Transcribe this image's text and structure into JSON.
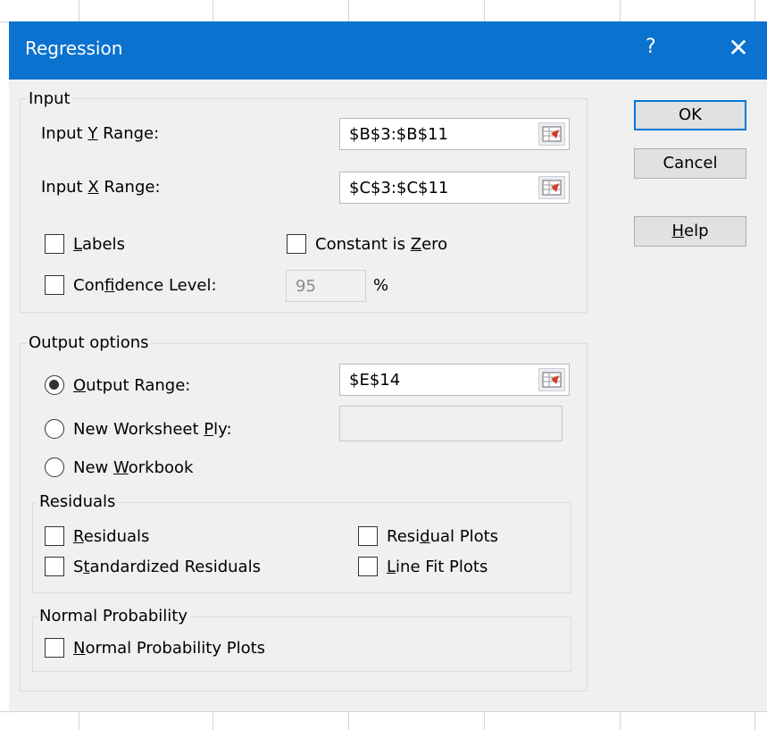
{
  "dialog": {
    "title": "Regression",
    "help_glyph": "?",
    "close_glyph": "✕"
  },
  "buttons": {
    "ok": "OK",
    "cancel": "Cancel",
    "help_prefix": "",
    "help_mnemonic": "H",
    "help_rest": "elp"
  },
  "input": {
    "legend": "Input",
    "y_range": {
      "pre": "Input ",
      "mnemonic": "Y",
      "post": " Range:",
      "value": "$B$3:$B$11"
    },
    "x_range": {
      "pre": "Input ",
      "mnemonic": "X",
      "post": " Range:",
      "value": "$C$3:$C$11"
    },
    "labels": {
      "pre": "",
      "mnemonic": "L",
      "post": "abels",
      "checked": false
    },
    "constant_zero": {
      "pre": "Constant is ",
      "mnemonic": "Z",
      "post": "ero",
      "checked": false
    },
    "confidence": {
      "pre": "Con",
      "mnemonic": "f",
      "post": "idence Level:",
      "value": "95",
      "unit": "%",
      "checked": false
    }
  },
  "output": {
    "legend": "Output options",
    "output_range": {
      "pre": "",
      "mnemonic": "O",
      "post": "utput Range:",
      "value": "$E$14",
      "selected": true
    },
    "new_worksheet": {
      "pre": "New Worksheet ",
      "mnemonic": "P",
      "post": "ly:",
      "value": "",
      "selected": false
    },
    "new_workbook": {
      "pre": "New ",
      "mnemonic": "W",
      "post": "orkbook",
      "selected": false
    }
  },
  "residuals": {
    "legend": "Residuals",
    "residuals": {
      "pre": "",
      "mnemonic": "R",
      "post": "esiduals",
      "checked": false
    },
    "standardized": {
      "pre": "S",
      "mnemonic": "t",
      "post": "andardized Residuals",
      "checked": false
    },
    "residual_plots": {
      "pre": "Resi",
      "mnemonic": "d",
      "post": "ual Plots",
      "checked": false
    },
    "line_fit": {
      "pre": "",
      "mnemonic": "L",
      "post": "ine Fit Plots",
      "checked": false
    }
  },
  "normal": {
    "legend": "Normal Probability",
    "plots": {
      "pre": "",
      "mnemonic": "N",
      "post": "ormal Probability Plots",
      "checked": false
    }
  },
  "colors": {
    "titlebar": "#0b72cf",
    "dialog_bg": "#f0f0f0",
    "default_button_border": "#0078d7"
  },
  "icons": {
    "range_picker": "collapse-dialog-icon"
  }
}
